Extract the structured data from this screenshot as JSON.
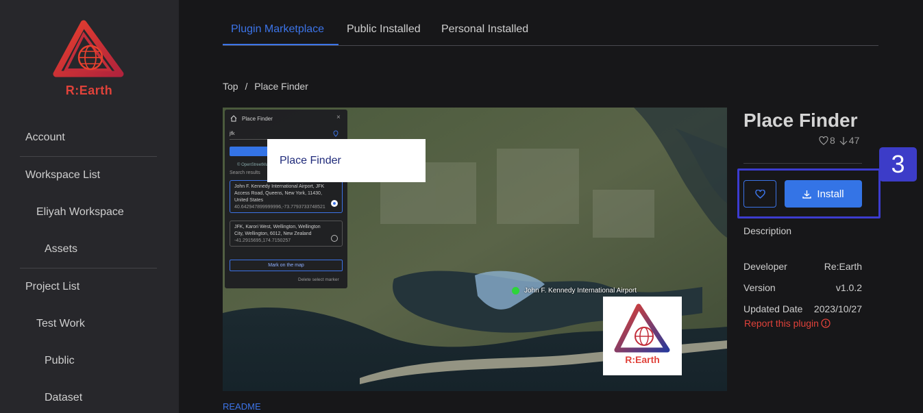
{
  "brand": {
    "name": "R:Earth",
    "color": "#e0423a"
  },
  "sidebar": {
    "items": [
      {
        "label": "Account"
      },
      {
        "label": "Workspace List"
      },
      {
        "label": "Eliyah Workspace"
      },
      {
        "label": "Assets"
      },
      {
        "label": "Project List"
      },
      {
        "label": "Test Work"
      },
      {
        "label": "Public"
      },
      {
        "label": "Dataset"
      }
    ]
  },
  "tabs": [
    {
      "label": "Plugin Marketplace",
      "active": true
    },
    {
      "label": "Public Installed",
      "active": false
    },
    {
      "label": "Personal Installed",
      "active": false
    }
  ],
  "breadcrumb": {
    "root": "Top",
    "separator": "/",
    "current": "Place Finder"
  },
  "hero": {
    "title_card": "Place Finder",
    "logo_text": "R:Earth",
    "map_label": "John F. Kennedy International Airport",
    "panel": {
      "title": "Place Finder",
      "search_value": "jfk",
      "attribution": "© OpenStreetMap",
      "results_label": "Search results",
      "results": [
        {
          "text": "John F. Kennedy International Airport, JFK Access Road, Queens, New York, 11430, United States",
          "coords": "40.642947899999996,-73.7793733748521",
          "selected": true
        },
        {
          "text": "JFK, Karori West, Wellington, Wellington City, Wellington, 6012, New Zealand",
          "coords": "-41.2915695,174.7150257",
          "selected": false
        }
      ],
      "mark_button": "Mark on the map",
      "delete_label": "Delete select marker"
    }
  },
  "plugin": {
    "name": "Place Finder",
    "likes": "8",
    "downloads": "47",
    "install_label": "Install",
    "description_label": "Description",
    "meta": [
      {
        "label": "Developer",
        "value": "Re:Earth"
      },
      {
        "label": "Version",
        "value": "v1.0.2"
      },
      {
        "label": "Updated Date",
        "value": "2023/10/27"
      }
    ],
    "report_label": "Report this plugin"
  },
  "annotation": {
    "badge": "3",
    "color": "#3c3cd0"
  },
  "readme_label": "README",
  "colors": {
    "accent": "#3c74e8",
    "sidebar_bg": "#27272b",
    "page_bg": "#171719"
  }
}
